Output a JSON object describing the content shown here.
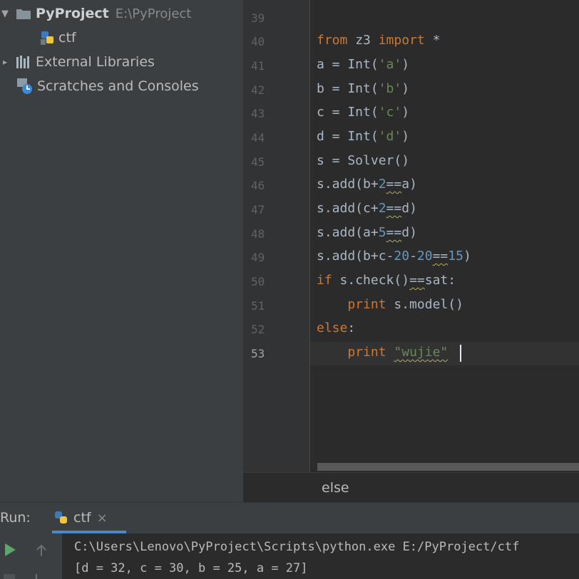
{
  "project_tree": {
    "root_name": "PyProject",
    "root_path": "E:\\PyProject",
    "file": "ctf",
    "external_libraries": "External Libraries",
    "scratches": "Scratches and Consoles"
  },
  "editor": {
    "line_numbers": [
      "39",
      "40",
      "41",
      "42",
      "43",
      "44",
      "45",
      "46",
      "47",
      "48",
      "49",
      "50",
      "51",
      "52",
      "53"
    ],
    "current_line": "53",
    "breadcrumb": "else"
  },
  "run": {
    "label": "Run:",
    "tab": "ctf",
    "close": "×",
    "output": [
      "C:\\Users\\Lenovo\\PyProject\\Scripts\\python.exe E:/PyProject/ctf",
      "[d = 32, c = 30, b = 25, a = 27]"
    ]
  },
  "colors": {
    "keyword": "#cc7832",
    "string": "#6a8759",
    "number": "#6897bb",
    "text": "#a9b7c6",
    "accent": "#4a88c7"
  }
}
